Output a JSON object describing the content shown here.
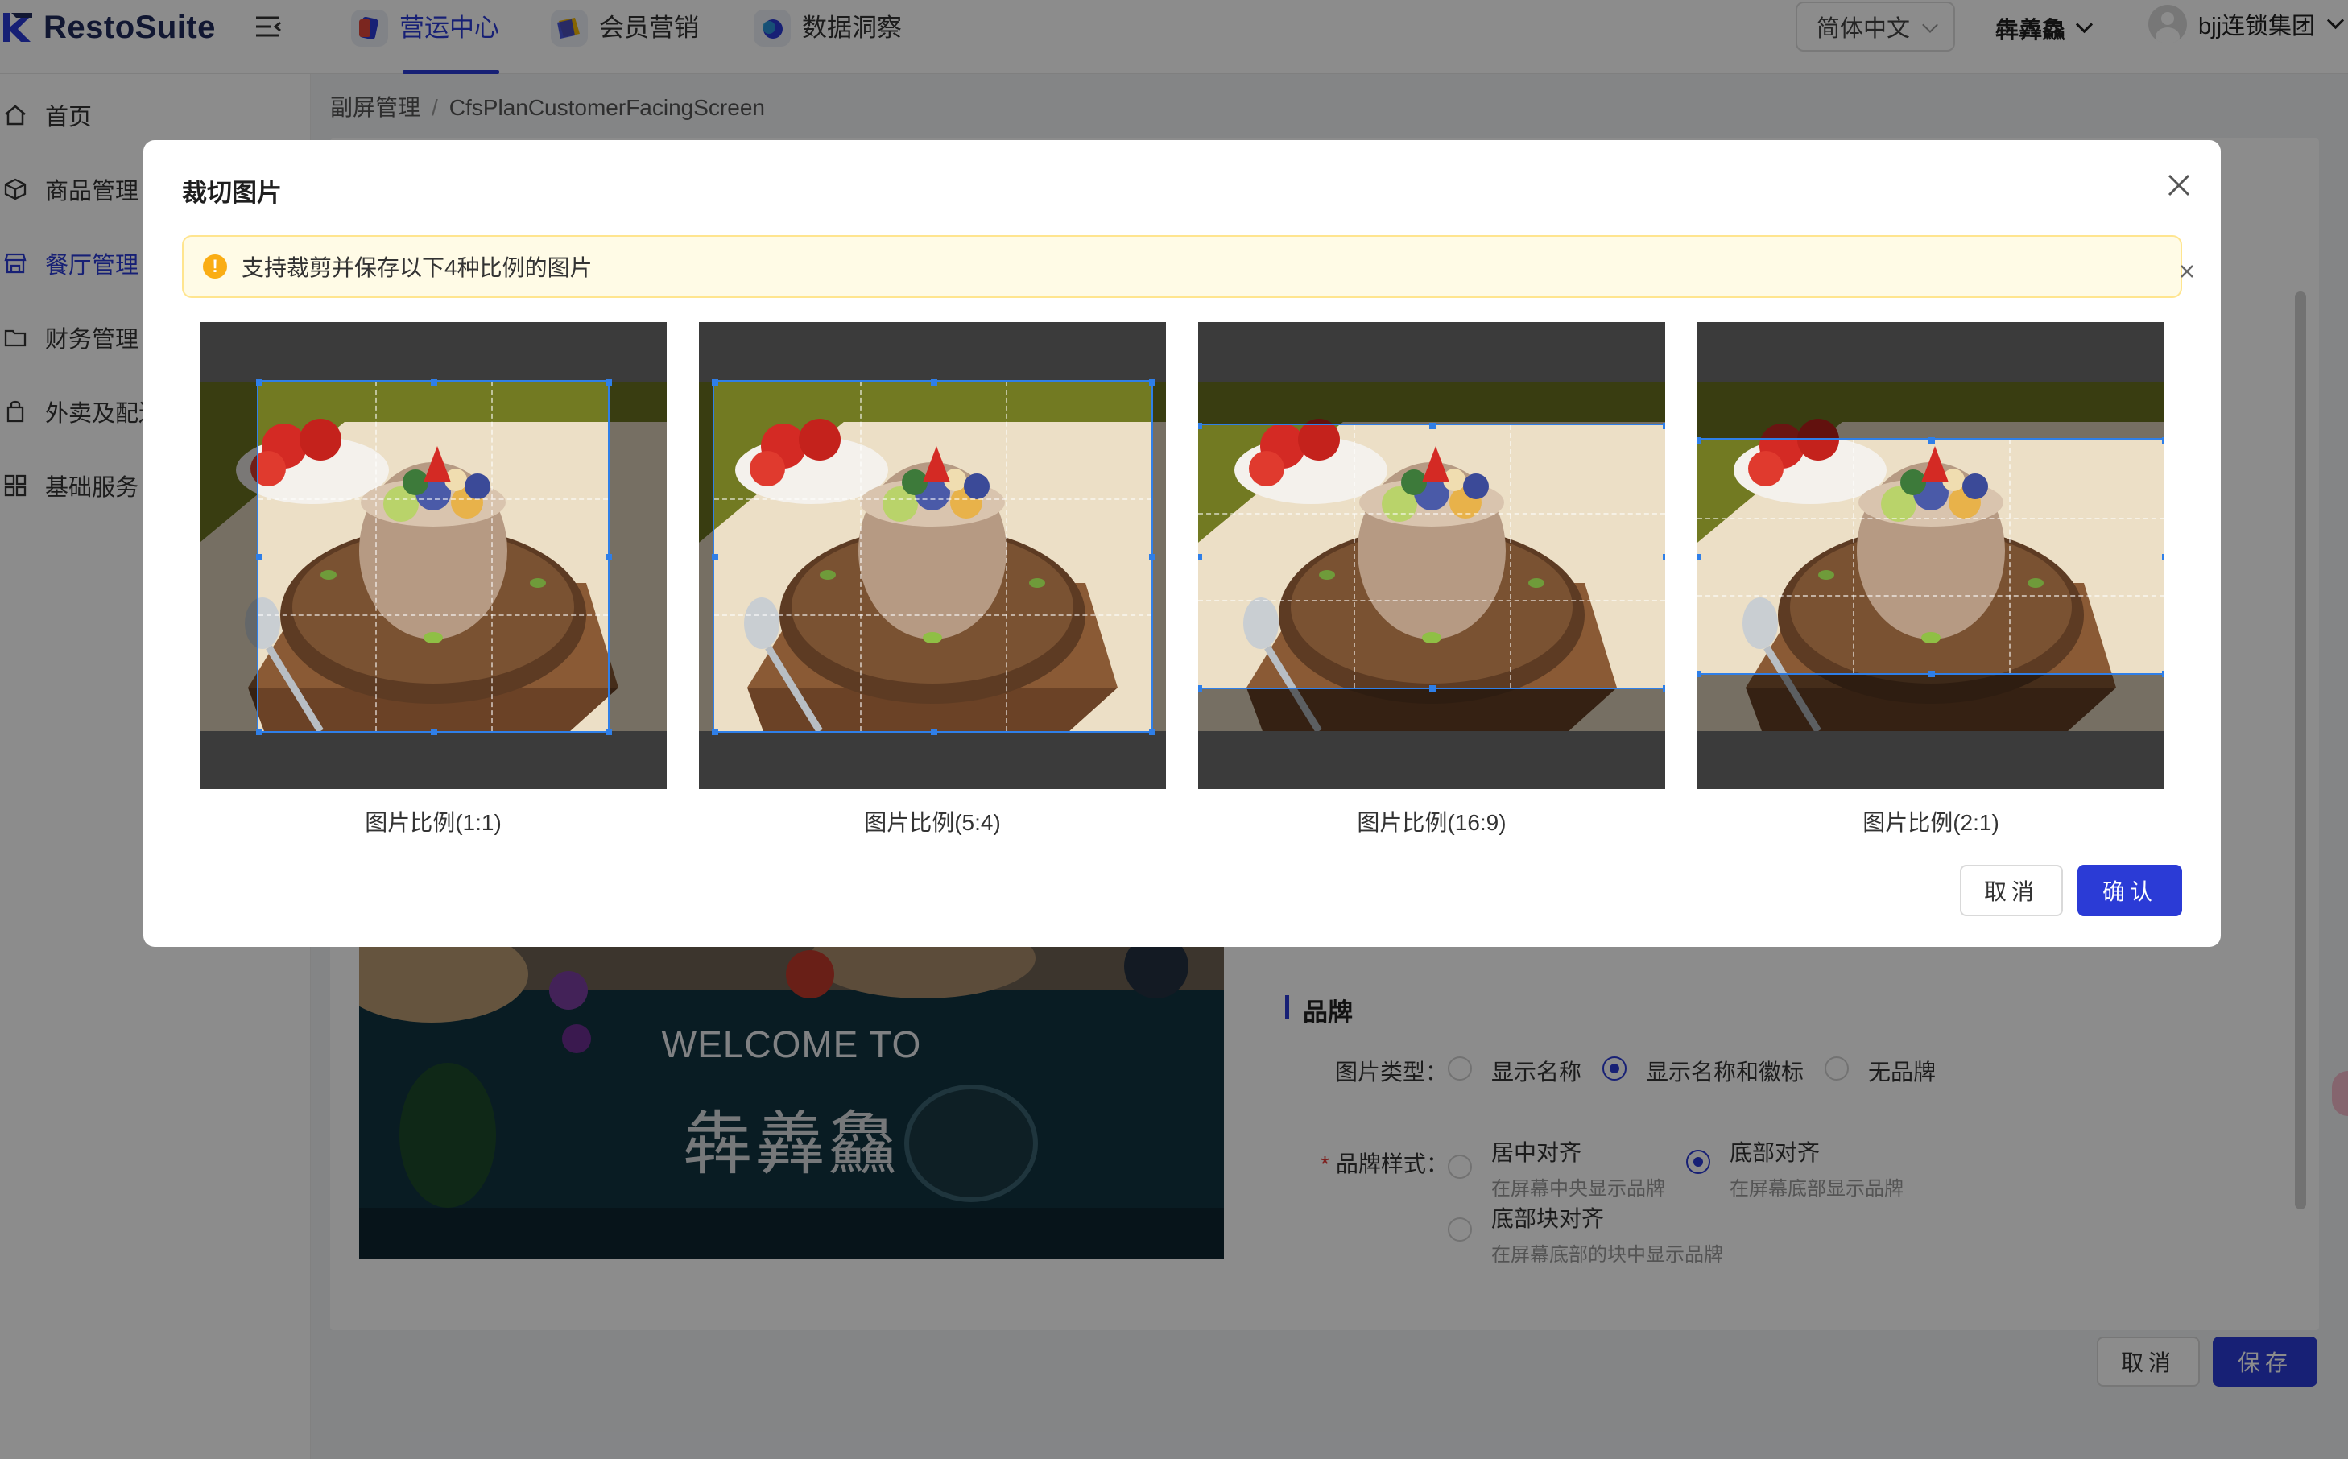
{
  "app": {
    "logo_text": "RestoSuite"
  },
  "top_nav": {
    "tabs": [
      {
        "label": "营运中心",
        "icon": "operations-icon"
      },
      {
        "label": "会员营销",
        "icon": "marketing-icon"
      },
      {
        "label": "数据洞察",
        "icon": "insight-icon"
      }
    ],
    "language": "简体中文",
    "brand": "犇羴鱻",
    "user": "bjj连锁集团"
  },
  "sidebar": {
    "items": [
      {
        "label": "首页",
        "icon": "home-icon"
      },
      {
        "label": "商品管理",
        "icon": "cube-icon"
      },
      {
        "label": "餐厅管理",
        "icon": "store-icon"
      },
      {
        "label": "财务管理",
        "icon": "folder-icon"
      },
      {
        "label": "外卖及配送",
        "icon": "bag-icon"
      },
      {
        "label": "基础服务",
        "icon": "grid-icon"
      }
    ]
  },
  "breadcrumb": {
    "parent": "副屏管理",
    "separator": "/",
    "current": "CfsPlanCustomerFacingScreen"
  },
  "preview": {
    "welcome": "WELCOME TO",
    "brand_name": "犇羴鱻"
  },
  "brand_section": {
    "title": "品牌",
    "image_type": {
      "label": "图片类型：",
      "options": [
        "显示名称",
        "显示名称和徽标",
        "无品牌"
      ],
      "selected": "显示名称和徽标"
    },
    "brand_style": {
      "label": "品牌样式：",
      "options": [
        {
          "title": "居中对齐",
          "desc": "在屏幕中央显示品牌"
        },
        {
          "title": "底部对齐",
          "desc": "在屏幕底部显示品牌"
        },
        {
          "title": "底部块对齐",
          "desc": "在屏幕底部的块中显示品牌"
        }
      ],
      "selected": "底部对齐"
    }
  },
  "page_actions": {
    "cancel": "取消",
    "save": "保存"
  },
  "modal": {
    "title": "裁切图片",
    "alert": "支持裁剪并保存以下4种比例的图片",
    "crops": [
      {
        "label": "图片比例(1:1)",
        "ratio": 1.0
      },
      {
        "label": "图片比例(5:4)",
        "ratio": 1.25
      },
      {
        "label": "图片比例(16:9)",
        "ratio": 1.7778
      },
      {
        "label": "图片比例(2:1)",
        "ratio": 2.0
      }
    ],
    "cancel": "取消",
    "confirm": "确认"
  },
  "colors": {
    "primary": "#2b3bd6",
    "crop_frame": "#2f7fe8",
    "alert_bg": "#fffbe6",
    "alert_icon": "#faad14"
  }
}
